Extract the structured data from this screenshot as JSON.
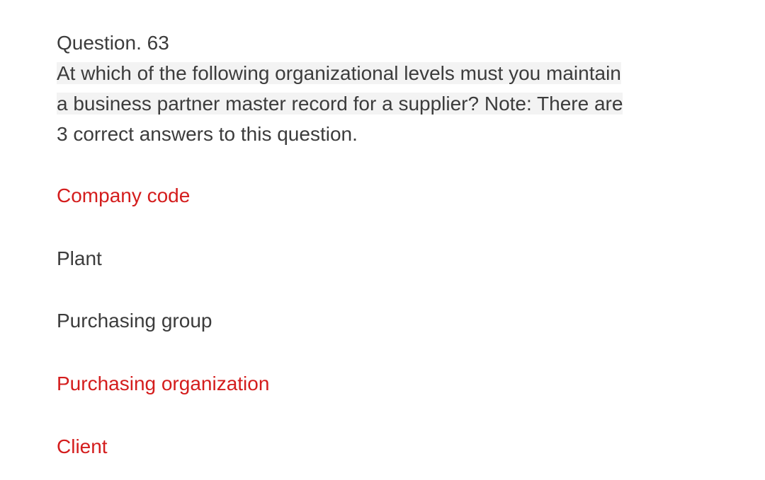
{
  "question": {
    "number": "Question. 63",
    "line1": "At which of the following organizational levels must you maintain",
    "line2": "a business partner master record for a supplier? Note: There are",
    "line3": "3 correct answers to this question."
  },
  "options": [
    {
      "label": "Company code",
      "correct": true
    },
    {
      "label": "Plant",
      "correct": false
    },
    {
      "label": "Purchasing group",
      "correct": false
    },
    {
      "label": "Purchasing organization",
      "correct": true
    },
    {
      "label": "Client",
      "correct": true
    }
  ],
  "colors": {
    "correct": "#d41d1d",
    "normal": "#3c3c3c",
    "highlight": "#f3f3f3"
  }
}
